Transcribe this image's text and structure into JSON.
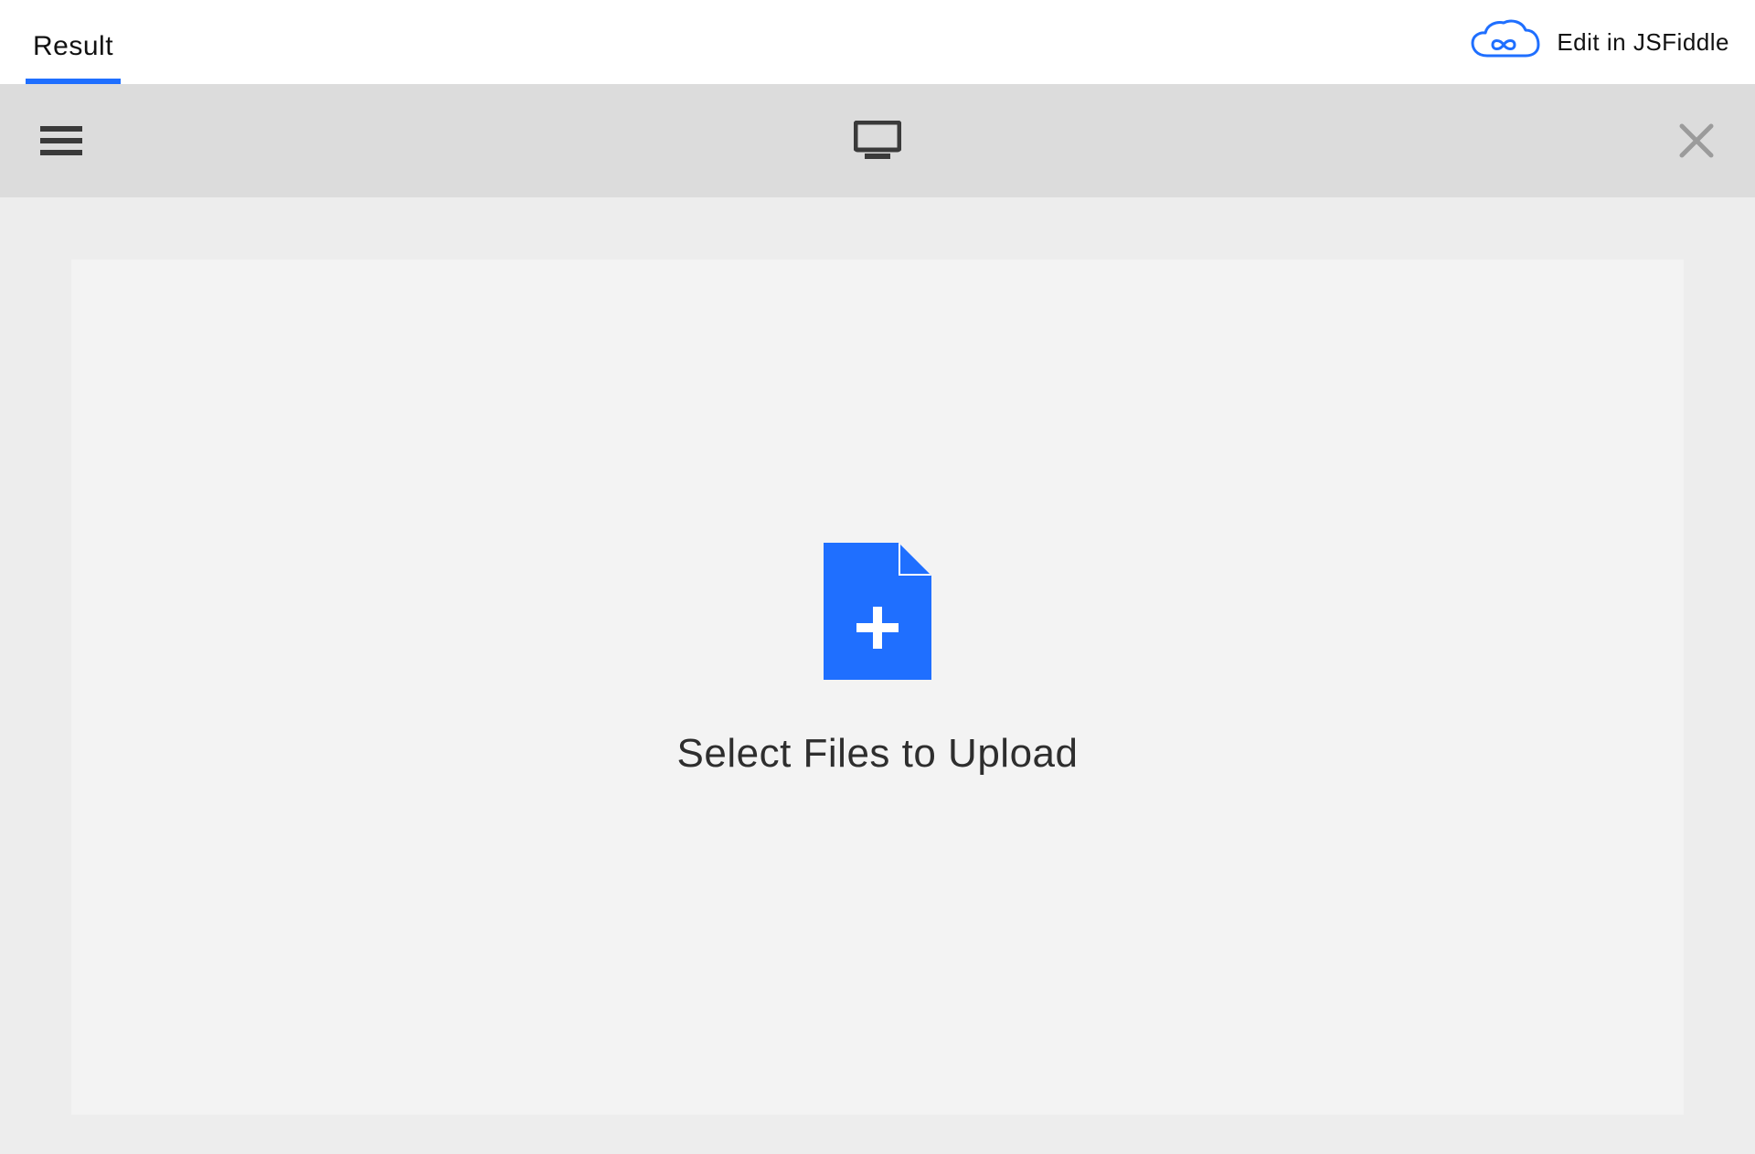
{
  "jsfiddle": {
    "tabs": {
      "result": "Result"
    },
    "edit_label": "Edit in JSFiddle"
  },
  "uploader": {
    "prompt": "Select Files to Upload"
  },
  "icons": {
    "hamburger": "hamburger-icon",
    "monitor": "monitor-icon",
    "close": "close-icon",
    "cloud": "cloud-infinity-icon",
    "file_add": "file-add-icon"
  },
  "colors": {
    "accent_blue": "#1f6fff",
    "file_blue": "#1f6fff",
    "header_grey": "#dcdcdc",
    "body_grey": "#ededed",
    "dropzone_grey": "#f3f3f3",
    "icon_dark": "#3a3a3a",
    "icon_muted": "#9b9b9b"
  }
}
